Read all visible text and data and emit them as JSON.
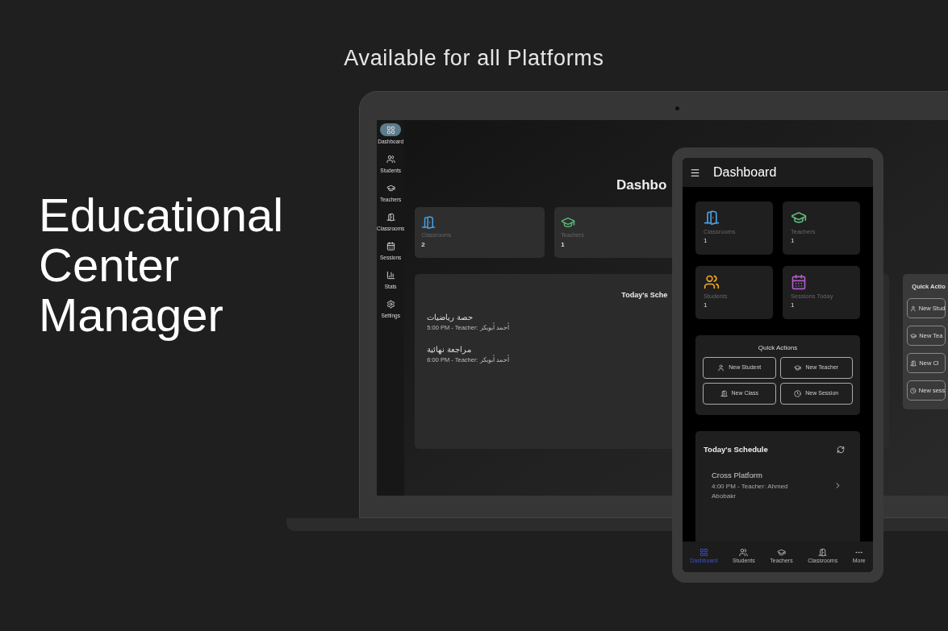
{
  "headline": "Available for all Platforms",
  "title": "Educational Center Manager",
  "laptop": {
    "sidebar": [
      {
        "label": "Dashboard",
        "kind": "grid",
        "selected": true
      },
      {
        "label": "Students",
        "kind": "people",
        "selected": false
      },
      {
        "label": "Teachers",
        "kind": "cap",
        "selected": false
      },
      {
        "label": "Classrooms",
        "kind": "door",
        "selected": false
      },
      {
        "label": "Sessions",
        "kind": "calendar",
        "selected": false
      },
      {
        "label": "Stats",
        "kind": "chart",
        "selected": false
      },
      {
        "label": "Settings",
        "kind": "gear",
        "selected": false
      }
    ],
    "page_title": "Dashbo",
    "stats": [
      {
        "label": "Classrooms",
        "value": "2",
        "kind": "door",
        "color": "#4a9ee0"
      },
      {
        "label": "Teachers",
        "value": "1",
        "kind": "cap",
        "color": "#5cb87a"
      }
    ],
    "schedule": {
      "title": "Today's Sche",
      "items": [
        {
          "name": "حصة رياضيات",
          "detail": "5:00 PM - Teacher: أحمد أبوبكر"
        },
        {
          "name": "مراجعة نهائية",
          "detail": "6:00 PM - Teacher: أحمد أبوبكر"
        }
      ]
    },
    "quick_actions": {
      "title": "Quick Actio",
      "buttons": [
        {
          "label": "New Stud",
          "kind": "person"
        },
        {
          "label": "New Tea",
          "kind": "cap"
        },
        {
          "label": "New Cl",
          "kind": "door"
        },
        {
          "label": "New sess",
          "kind": "clock"
        }
      ]
    }
  },
  "phone": {
    "title": "Dashboard",
    "stats": [
      {
        "label": "Classrooms",
        "value": "1",
        "kind": "door",
        "color": "#4a9ee0"
      },
      {
        "label": "Teachers",
        "value": "1",
        "kind": "cap",
        "color": "#5cb87a"
      },
      {
        "label": "Students",
        "value": "1",
        "kind": "people",
        "color": "#f5a623"
      },
      {
        "label": "Sessions Today",
        "value": "1",
        "kind": "calendar",
        "color": "#b05cc8"
      }
    ],
    "quick_actions": {
      "title": "Quick Actions",
      "buttons": [
        {
          "label": "New Student",
          "kind": "person"
        },
        {
          "label": "New Teacher",
          "kind": "cap"
        },
        {
          "label": "New Class",
          "kind": "door"
        },
        {
          "label": "New Session",
          "kind": "clock"
        }
      ]
    },
    "schedule": {
      "title": "Today's Schedule",
      "items": [
        {
          "name": "Cross Platform",
          "detail": "4:00 PM - Teacher: Ahmed Abobakr"
        }
      ]
    },
    "nav": [
      {
        "label": "Dashboard",
        "kind": "grid",
        "selected": true
      },
      {
        "label": "Students",
        "kind": "people",
        "selected": false
      },
      {
        "label": "Teachers",
        "kind": "cap",
        "selected": false
      },
      {
        "label": "Classrooms",
        "kind": "door",
        "selected": false
      },
      {
        "label": "More",
        "kind": "dots",
        "selected": false
      }
    ]
  }
}
